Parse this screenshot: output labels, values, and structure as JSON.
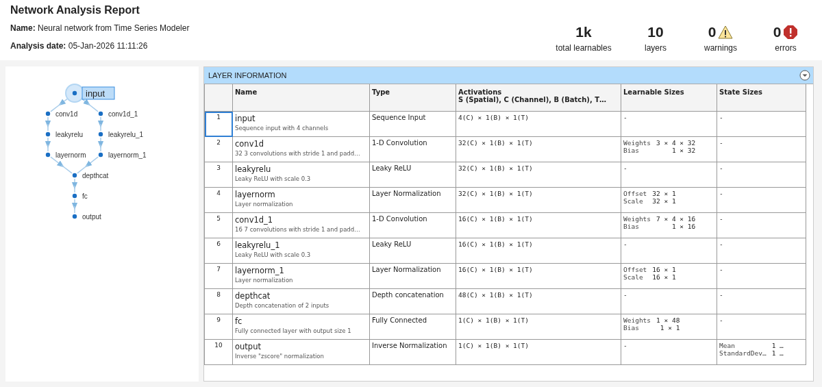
{
  "report": {
    "title": "Network Analysis Report",
    "fields": [
      {
        "label": "Name:",
        "value": "Neural network from Time Series Modeler"
      },
      {
        "label": "Analysis date:",
        "value": "05-Jan-2026 11:11:26"
      }
    ]
  },
  "stats": [
    {
      "value": "1k",
      "label": "total learnables",
      "kind": "plain"
    },
    {
      "value": "10",
      "label": "layers",
      "kind": "plain"
    },
    {
      "value": "0",
      "label": "warnings",
      "kind": "warning"
    },
    {
      "value": "0",
      "label": "errors",
      "kind": "error"
    }
  ],
  "graph": {
    "nodes": [
      {
        "name": "input",
        "selected": true
      },
      {
        "name": "conv1d",
        "selected": false
      },
      {
        "name": "conv1d_1",
        "selected": false
      },
      {
        "name": "leakyrelu",
        "selected": false
      },
      {
        "name": "leakyrelu_1",
        "selected": false
      },
      {
        "name": "layernorm",
        "selected": false
      },
      {
        "name": "layernorm_1",
        "selected": false
      },
      {
        "name": "depthcat",
        "selected": false
      },
      {
        "name": "fc",
        "selected": false
      },
      {
        "name": "output",
        "selected": false
      }
    ]
  },
  "layer_table": {
    "title": "LAYER INFORMATION",
    "columns": [
      "Name",
      "Type",
      "Activations",
      "Learnable Sizes",
      "State Sizes"
    ],
    "activations_subtitle": "S (Spatial), C (Channel), B (Batch), T…",
    "rows": [
      {
        "index": "1",
        "name": "input",
        "description": "Sequence input with 4 channels",
        "type": "Sequence Input",
        "activations": "4(C) × 1(B) × 1(T)",
        "learnables": "-",
        "states": "-",
        "selected": true
      },
      {
        "index": "2",
        "name": "conv1d",
        "description": "32 3 convolutions with stride 1 and padd…",
        "type": "1-D Convolution",
        "activations": "32(C) × 1(B) × 1(T)",
        "learnables": [
          {
            "name": "Weights",
            "size": "3 × 4 × 32"
          },
          {
            "name": "Bias",
            "size": "1 × 32"
          }
        ],
        "states": "-",
        "selected": false
      },
      {
        "index": "3",
        "name": "leakyrelu",
        "description": "Leaky ReLU with scale 0.3",
        "type": "Leaky ReLU",
        "activations": "32(C) × 1(B) × 1(T)",
        "learnables": "-",
        "states": "-",
        "selected": false
      },
      {
        "index": "4",
        "name": "layernorm",
        "description": "Layer normalization",
        "type": "Layer Normalization",
        "activations": "32(C) × 1(B) × 1(T)",
        "learnables": [
          {
            "name": "Offset",
            "size": "32 × 1"
          },
          {
            "name": "Scale",
            "size": "32 × 1"
          }
        ],
        "states": "-",
        "selected": false
      },
      {
        "index": "5",
        "name": "conv1d_1",
        "description": "16 7 convolutions with stride 1 and padd…",
        "type": "1-D Convolution",
        "activations": "16(C) × 1(B) × 1(T)",
        "learnables": [
          {
            "name": "Weights",
            "size": "7 × 4 × 16"
          },
          {
            "name": "Bias",
            "size": "1 × 16"
          }
        ],
        "states": "-",
        "selected": false
      },
      {
        "index": "6",
        "name": "leakyrelu_1",
        "description": "Leaky ReLU with scale 0.3",
        "type": "Leaky ReLU",
        "activations": "16(C) × 1(B) × 1(T)",
        "learnables": "-",
        "states": "-",
        "selected": false
      },
      {
        "index": "7",
        "name": "layernorm_1",
        "description": "Layer normalization",
        "type": "Layer Normalization",
        "activations": "16(C) × 1(B) × 1(T)",
        "learnables": [
          {
            "name": "Offset",
            "size": "16 × 1"
          },
          {
            "name": "Scale",
            "size": "16 × 1"
          }
        ],
        "states": "-",
        "selected": false
      },
      {
        "index": "8",
        "name": "depthcat",
        "description": "Depth concatenation of 2 inputs",
        "type": "Depth concatenation",
        "activations": "48(C) × 1(B) × 1(T)",
        "learnables": "-",
        "states": "-",
        "selected": false
      },
      {
        "index": "9",
        "name": "fc",
        "description": "Fully connected layer with output size 1",
        "type": "Fully Connected",
        "activations": "1(C) × 1(B) × 1(T)",
        "learnables": [
          {
            "name": "Weights",
            "size": "1 × 48"
          },
          {
            "name": "Bias",
            "size": "1 × 1"
          }
        ],
        "states": "-",
        "selected": false
      },
      {
        "index": "10",
        "name": "output",
        "description": "Inverse \"zscore\" normalization",
        "type": "Inverse Normalization",
        "activations": "1(C) × 1(B) × 1(T)",
        "learnables": "-",
        "states": [
          {
            "name": "Mean",
            "size": "1 …"
          },
          {
            "name": "StandardDev…",
            "size": "1 …"
          }
        ],
        "selected": false
      }
    ]
  }
}
